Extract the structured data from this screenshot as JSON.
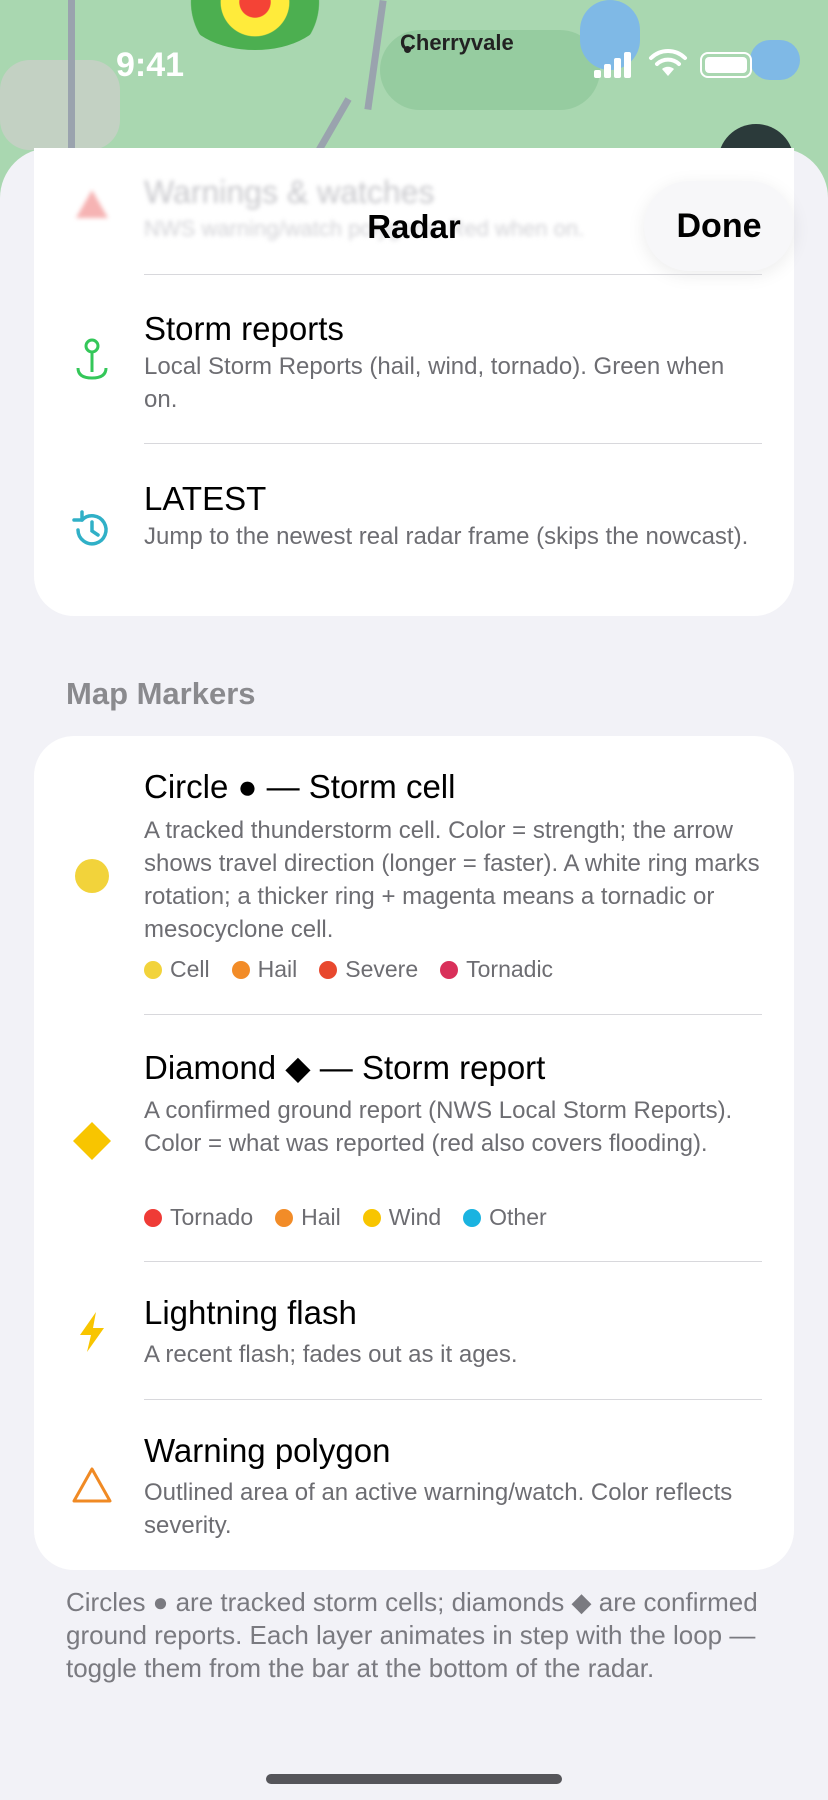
{
  "status_bar": {
    "time": "9:41"
  },
  "map": {
    "city_label": "Cherryvale"
  },
  "sheet": {
    "title": "Radar",
    "done_label": "Done",
    "faded_row": {
      "title": "Warnings & watches",
      "desc": "NWS warning/watch polygons. Red when on."
    },
    "top_rows": [
      {
        "title": "Storm reports",
        "desc": "Local Storm Reports (hail, wind, tornado). Green when on.",
        "icon": "storm-report-pin-icon",
        "color": "#34C759"
      },
      {
        "title": "LATEST",
        "desc": "Jump to the newest real radar frame (skips the nowcast).",
        "icon": "history-clock-icon",
        "color": "#30B0C7"
      }
    ],
    "section_label": "Map Markers",
    "markers": [
      {
        "title": "Circle ● — Storm cell",
        "desc": "A tracked thunderstorm cell. Color = strength; the arrow shows travel direction (longer = faster). A white ring marks rotation; a thicker ring + magenta means a tornadic or mesocyclone cell.",
        "icon": "yellow-circle-icon",
        "legend": [
          {
            "label": "Cell",
            "color": "#F2D33B"
          },
          {
            "label": "Hail",
            "color": "#F28C28"
          },
          {
            "label": "Severe",
            "color": "#E8482E"
          },
          {
            "label": "Tornadic",
            "color": "#D9305A"
          }
        ]
      },
      {
        "title": "Diamond ◆ — Storm report",
        "desc": "A confirmed ground report (NWS Local Storm Reports). Color = what was reported (red also covers flooding).",
        "icon": "yellow-diamond-icon",
        "legend": [
          {
            "label": "Tornado",
            "color": "#EF3B36"
          },
          {
            "label": "Hail",
            "color": "#F28C28"
          },
          {
            "label": "Wind",
            "color": "#F8C500"
          },
          {
            "label": "Other",
            "color": "#1AB3E0"
          }
        ]
      },
      {
        "title": "Lightning flash",
        "desc": "A recent flash; fades out as it ages.",
        "icon": "lightning-bolt-icon"
      },
      {
        "title": "Warning polygon",
        "desc": "Outlined area of an active warning/watch. Color reflects severity.",
        "icon": "warning-triangle-icon"
      }
    ],
    "footer": "Circles ● are tracked storm cells; diamonds ◆ are confirmed ground reports. Each layer animates in step with the loop — toggle them from the bar at the bottom of the radar."
  }
}
